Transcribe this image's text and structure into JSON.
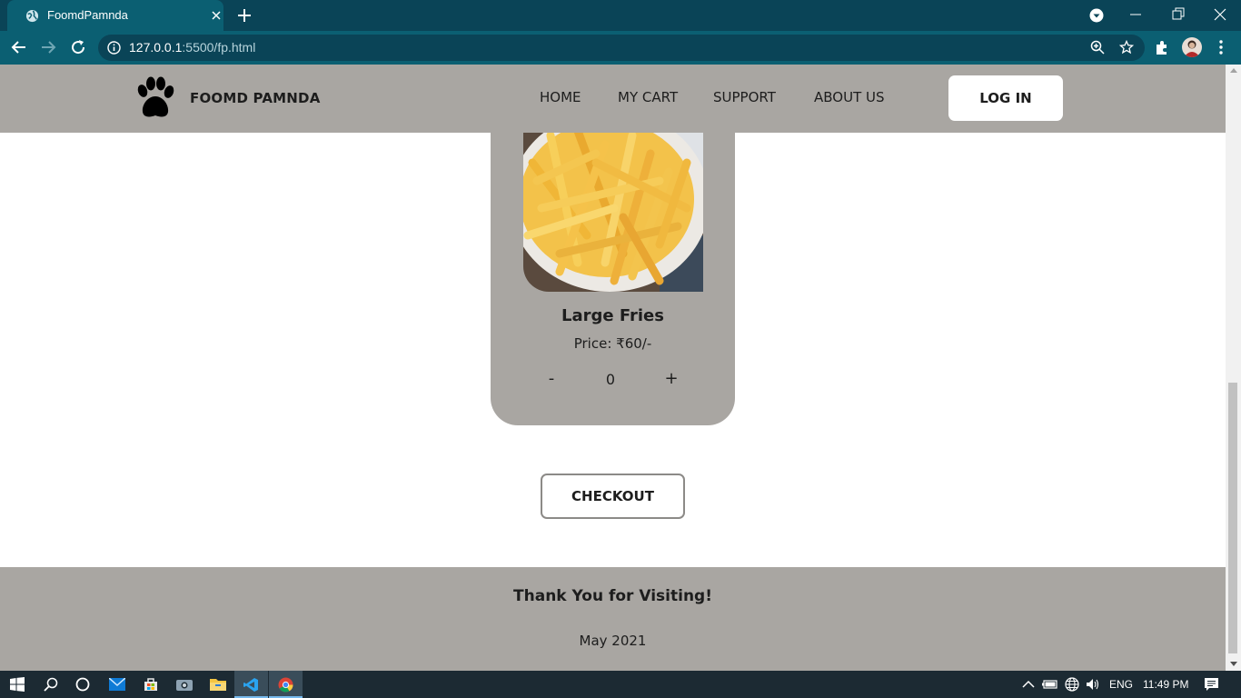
{
  "browser": {
    "tab_title": "FoomdPamnda",
    "url_host": "127.0.0.1",
    "url_rest": ":5500/fp.html"
  },
  "site": {
    "brand": "FOOMD PAMNDA",
    "nav": {
      "home": "HOME",
      "cart": "MY CART",
      "support": "SUPPORT",
      "about": "ABOUT US"
    },
    "login_label": "LOG IN"
  },
  "product": {
    "name": "Large Fries",
    "price": "Price: ₹60/-",
    "minus_label": "-",
    "quantity": "0",
    "plus_label": "+"
  },
  "checkout_label": "CHECKOUT",
  "footer": {
    "thanks": "Thank You for Visiting!",
    "date": "May 2021"
  },
  "taskbar": {
    "language": "ENG",
    "time": "11:49 PM"
  },
  "colors": {
    "header_bg": "#a9a6a2",
    "chrome_tab": "#0b5f72",
    "chrome_strip": "#0a4457"
  }
}
